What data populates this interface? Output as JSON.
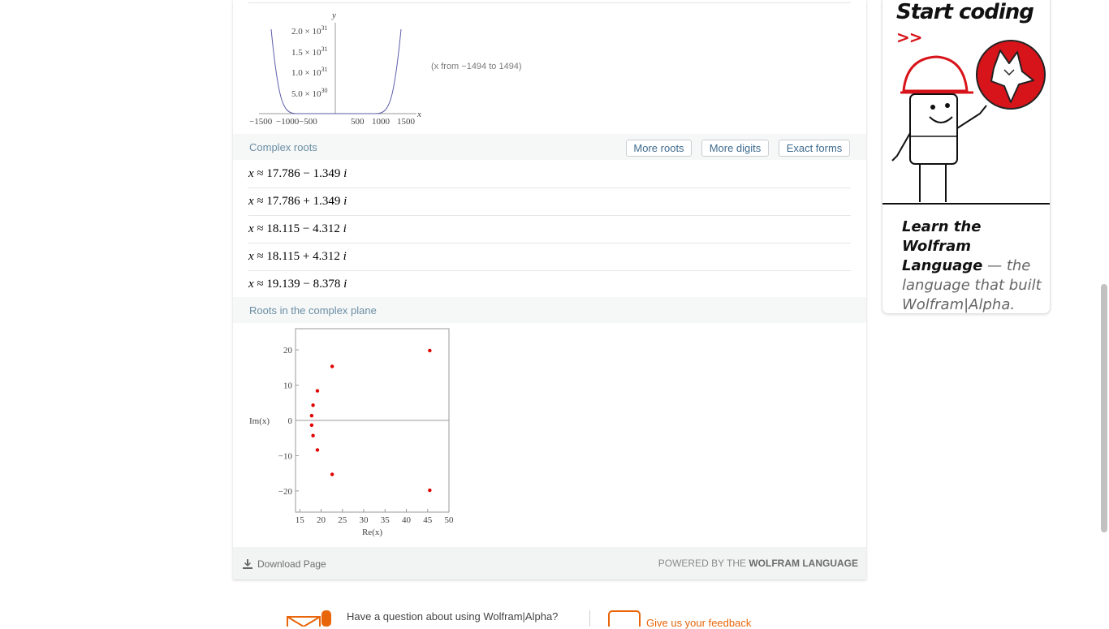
{
  "plot1": {
    "y_label": "y",
    "x_label": "x",
    "y_ticks": [
      {
        "mant": "2.0",
        "exp": "31"
      },
      {
        "mant": "1.5",
        "exp": "31"
      },
      {
        "mant": "1.0",
        "exp": "31"
      },
      {
        "mant": "5.0",
        "exp": "30"
      }
    ],
    "x_ticks": [
      "−1500",
      "−1000",
      "−500",
      "500",
      "1000",
      "1500"
    ],
    "note": "(x from −1494 to 1494)"
  },
  "complex_roots": {
    "title": "Complex roots",
    "buttons": {
      "more_roots": "More roots",
      "more_digits": "More digits",
      "exact_forms": "Exact forms"
    },
    "rows": [
      {
        "var": "x",
        "rel": "≈",
        "re": "17.786",
        "op": "−",
        "im": "1.349",
        "unit": "i"
      },
      {
        "var": "x",
        "rel": "≈",
        "re": "17.786",
        "op": "+",
        "im": "1.349",
        "unit": "i"
      },
      {
        "var": "x",
        "rel": "≈",
        "re": "18.115",
        "op": "−",
        "im": "4.312",
        "unit": "i"
      },
      {
        "var": "x",
        "rel": "≈",
        "re": "18.115",
        "op": "+",
        "im": "4.312",
        "unit": "i"
      },
      {
        "var": "x",
        "rel": "≈",
        "re": "19.139",
        "op": "−",
        "im": "8.378",
        "unit": "i"
      }
    ]
  },
  "roots_plane": {
    "title": "Roots in the complex plane"
  },
  "chart_data": [
    {
      "type": "line",
      "xlabel": "x",
      "ylabel": "y",
      "xlim": [
        -1494,
        1494
      ],
      "ylim": [
        0,
        2.2e+31
      ],
      "x_tick_labels": [
        "−1500",
        "−1000",
        "−500",
        "500",
        "1000",
        "1500"
      ],
      "y_tick_labels": [
        "5.0×10^30",
        "1.0×10^31",
        "1.5×10^31",
        "2.0×10^31"
      ],
      "color": "#5b5baa"
    },
    {
      "type": "scatter",
      "xlabel": "Re(x)",
      "ylabel": "Im(x)",
      "xlim": [
        14,
        50
      ],
      "ylim": [
        -26,
        26
      ],
      "x_ticks": [
        15,
        20,
        25,
        30,
        35,
        40,
        45,
        50
      ],
      "y_ticks": [
        -20,
        -10,
        0,
        10,
        20
      ],
      "y_tick_labels": [
        "−20",
        "−10",
        "0",
        "10",
        "20"
      ],
      "x": [
        17.786,
        17.786,
        18.115,
        18.115,
        19.139,
        19.139,
        22.6,
        22.6,
        45.5,
        45.5
      ],
      "y": [
        -1.349,
        1.349,
        -4.312,
        4.312,
        -8.378,
        8.378,
        -15.3,
        15.3,
        -19.8,
        19.8
      ],
      "color": "#e00000"
    }
  ],
  "footer": {
    "download": "Download Page",
    "powered_prefix": "POWERED BY THE",
    "powered_brand": "WOLFRAM LANGUAGE"
  },
  "ad": {
    "title": "Start coding",
    "chevron": ">>",
    "text_bold": "Learn the Wolfram Language",
    "text_rest": "— the language that built Wolfram|Alpha."
  },
  "bottom": {
    "question": "Have a question about using Wolfram|Alpha?",
    "feedback": "Give us your feedback"
  }
}
